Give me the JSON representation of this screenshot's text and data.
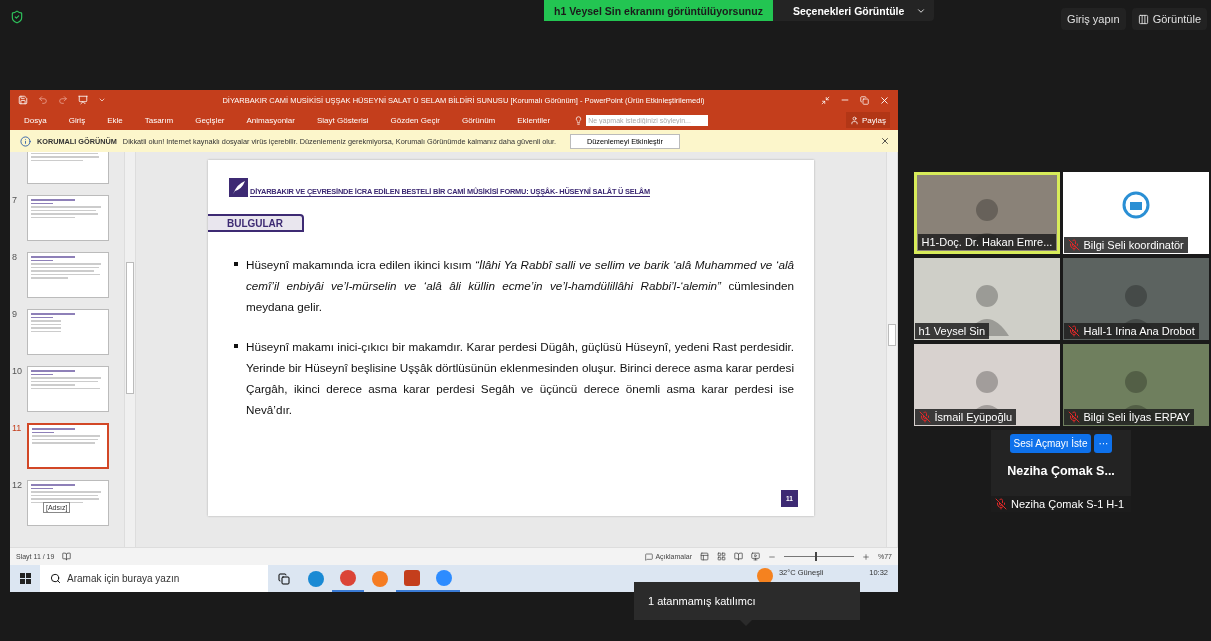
{
  "meeting_bar": {
    "share_banner": "h1 Veysel Sin ekranını görüntülüyorsunuz",
    "options_button": "Seçenekleri Görüntüle",
    "signin_button": "Giriş yapın",
    "view_button": "Görüntüle"
  },
  "powerpoint": {
    "title": "DİYARBAKIR CAMİ MUSİKİSİ UŞŞAK HÜSEYNİ SALAT Ü SELAM BİLDİRİ SUNUSU [Korumalı Görünüm] - PowerPoint (Ürün Etkinleştirilemedi)",
    "menu": [
      {
        "label": "Dosya"
      },
      {
        "label": "Giriş"
      },
      {
        "label": "Ekle"
      },
      {
        "label": "Tasarım"
      },
      {
        "label": "Geçişler"
      },
      {
        "label": "Animasyonlar"
      },
      {
        "label": "Slayt Gösterisi"
      },
      {
        "label": "Gözden Geçir"
      },
      {
        "label": "Görünüm"
      },
      {
        "label": "Eklentiler"
      }
    ],
    "search_placeholder": "Ne yapmak istediğinizi söyleyin...",
    "share_button": "Paylaş",
    "protected_view": {
      "label": "KORUMALI GÖRÜNÜM",
      "message": "Dikkatli olun! Internet kaynaklı dosyalar virüs içerebilir. Düzenlemeniz gerekmiyorsa, Korumalı Görünümde kalmanız daha güvenli olur.",
      "button": "Düzenlemeyi Etkinleştir"
    },
    "thumbnails": [
      {
        "selected": false
      },
      {
        "number": "7",
        "selected": false
      },
      {
        "number": "8",
        "selected": false
      },
      {
        "number": "9",
        "selected": false
      },
      {
        "number": "10",
        "selected": false
      },
      {
        "number": "11",
        "selected": true
      },
      {
        "number": "12",
        "selected": false
      }
    ],
    "thumbnail_tooltip": "[Adsız]",
    "slide": {
      "header": "DİYARBAKIR VE ÇEVRESİNDE İCRA EDİLEN BESTELİ BİR CAMİ MÛSİKİSİ FORMU: UŞŞÂK- HÜSEYNÎ SALÂT Ü SELÂM",
      "section": "BULGULAR",
      "bullets": [
        "Hüseynî makamında icra edilen ikinci kısım *“İlâhi Ya Rabbî salli ve sellim ve barik ‘alâ Muhammed ve ‘alâ cemî’il enbiyâi ve’l-mürselin ve ‘alâ âli küllin ecme’in ve’l-hamdülillâhi Rabbi’l-‘alemin”* cümlesinden meydana gelir.",
        "Hüseynî makamı inici-çıkıcı bir makamdır. Karar perdesi Dügâh, güçlüsü Hüseynî, yedeni Rast perdesidir. Yerinde bir Hüseynî beşlisine Uşşâk dörtlüsünün eklenmesinden oluşur. Birinci derece asma karar perdesi Çargâh, ikinci derece asma karar perdesi Segâh ve üçüncü derece önemli asma karar perdesi ise Nevâ’dır."
      ],
      "page_number": "11"
    },
    "status": {
      "slide_counter": "Slayt 11 / 19",
      "notes_button": "Açıklamalar",
      "zoom_slider": {
        "level": 0.45
      },
      "zoom_percent": "%77"
    },
    "taskbar": {
      "search_placeholder": "Aramak için buraya yazın",
      "weather": "32°C Güneşli",
      "time": "10:32"
    }
  },
  "participants": [
    {
      "name": "H1-Doç. Dr. Hakan Emre...",
      "kind": "video",
      "muted": false,
      "speaking": true
    },
    {
      "name": "Bilgi Seli koordinatör",
      "kind": "logo",
      "muted": true,
      "speaking": false
    },
    {
      "name": "h1 Veysel Sin",
      "kind": "video",
      "muted": false,
      "speaking": false
    },
    {
      "name": "Hall-1 Irina Ana Drobot",
      "kind": "video",
      "muted": true,
      "speaking": false
    },
    {
      "name": "İsmail Eyüpoğlu",
      "kind": "video",
      "muted": true,
      "speaking": false
    },
    {
      "name": "Bilgi Seli İlyas ERPAY",
      "kind": "video",
      "muted": true,
      "speaking": false
    }
  ],
  "featured": {
    "unmute_button": "Sesi Açmayı İste",
    "more_button": "···",
    "title": "Neziha Çomak S...",
    "name": "Neziha Çomak S-1 H-1",
    "muted": true
  },
  "tooltip": "1 atanmamış katılımcı"
}
